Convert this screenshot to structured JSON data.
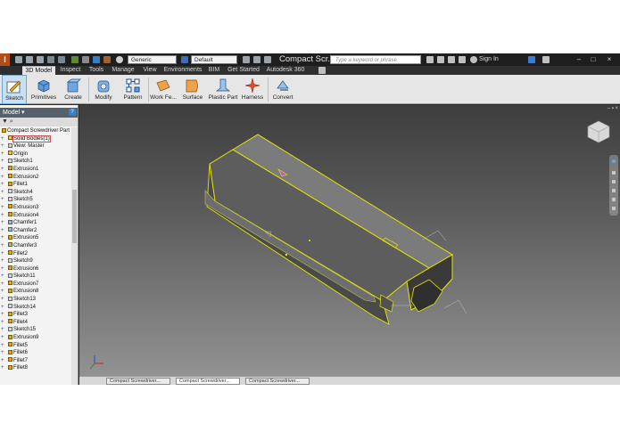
{
  "app": {
    "logo": "I",
    "document_title": "Compact Scr...",
    "appearance_style": "Generic",
    "material": "Default",
    "search_placeholder": "Type a keyword or phrase",
    "sign_in": "Sign In",
    "window_controls": [
      "–",
      "□",
      "×"
    ]
  },
  "ribbon": {
    "tabs": [
      "3D Model",
      "Inspect",
      "Tools",
      "Manage",
      "View",
      "Environments",
      "BIM",
      "Get Started",
      "Autodesk 360"
    ],
    "active_tab": "3D Model",
    "buttons": [
      {
        "label": "Sketch",
        "icon": "sketch-icon"
      },
      {
        "label": "Primitives",
        "icon": "primitives-icon"
      },
      {
        "label": "Create",
        "icon": "create-icon"
      },
      {
        "label": "Modify",
        "icon": "modify-icon"
      },
      {
        "label": "Pattern",
        "icon": "pattern-icon"
      },
      {
        "label": "Work Fe...",
        "icon": "work-features-icon"
      },
      {
        "label": "Surface",
        "icon": "surface-icon"
      },
      {
        "label": "Plastic Part",
        "icon": "plastic-part-icon"
      },
      {
        "label": "Harness",
        "icon": "harness-icon"
      },
      {
        "label": "Convert",
        "icon": "convert-icon"
      }
    ]
  },
  "browser": {
    "title": "Model",
    "help_label": "?",
    "tool_symbols": "▼  ⌕",
    "items": [
      {
        "label": "Compact Screwdriver Part",
        "kind": "part",
        "root": true
      },
      {
        "label": "Solid Bodies(1)",
        "kind": "folder",
        "selected": true
      },
      {
        "label": "View: Master",
        "kind": "sketch"
      },
      {
        "label": "Origin",
        "kind": "folder"
      },
      {
        "label": "Sketch1",
        "kind": "sketch"
      },
      {
        "label": "Extrusion1",
        "kind": "feature"
      },
      {
        "label": "Extrusion2",
        "kind": "feature"
      },
      {
        "label": "Fillet1",
        "kind": "feature"
      },
      {
        "label": "Sketch4",
        "kind": "sketch"
      },
      {
        "label": "Sketch5",
        "kind": "sketch"
      },
      {
        "label": "Extrusion3",
        "kind": "feature"
      },
      {
        "label": "Extrusion4",
        "kind": "feature"
      },
      {
        "label": "Chamfer1",
        "kind": "chamfer"
      },
      {
        "label": "Chamfer2",
        "kind": "chamfer"
      },
      {
        "label": "Extrusion5",
        "kind": "feature"
      },
      {
        "label": "Chamfer3",
        "kind": "chamfer"
      },
      {
        "label": "Fillet2",
        "kind": "feature"
      },
      {
        "label": "Sketch9",
        "kind": "sketch"
      },
      {
        "label": "Extrusion6",
        "kind": "feature"
      },
      {
        "label": "Sketch11",
        "kind": "sketch"
      },
      {
        "label": "Extrusion7",
        "kind": "feature"
      },
      {
        "label": "Extrusion8",
        "kind": "feature"
      },
      {
        "label": "Sketch13",
        "kind": "sketch"
      },
      {
        "label": "Sketch14",
        "kind": "sketch"
      },
      {
        "label": "Fillet3",
        "kind": "feature"
      },
      {
        "label": "Fillet4",
        "kind": "feature"
      },
      {
        "label": "Sketch15",
        "kind": "sketch"
      },
      {
        "label": "Extrusion9",
        "kind": "feature"
      },
      {
        "label": "Fillet5",
        "kind": "feature"
      },
      {
        "label": "Fillet6",
        "kind": "feature"
      },
      {
        "label": "Fillet7",
        "kind": "feature"
      },
      {
        "label": "Fillet8",
        "kind": "feature"
      }
    ]
  },
  "viewport": {
    "controls": "– ▪ ×",
    "model_outline_color": "#e6e600"
  },
  "doc_tabs": [
    "Compact Screwdriver...",
    "Compact Screwdriver...",
    "Compact Screwdriver..."
  ]
}
